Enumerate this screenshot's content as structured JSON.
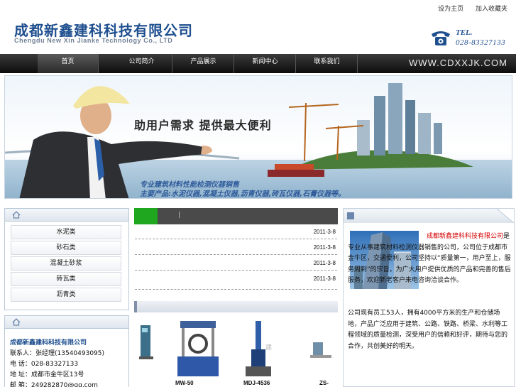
{
  "top_links": [
    "设为主页",
    "加入收藏夹"
  ],
  "logo": {
    "cn": "成都新鑫建科科技有限公司",
    "en": "Chengdu New Xin Jianke Technology Co., LTD"
  },
  "tel": {
    "label": "TEL.",
    "number": "028-83327133"
  },
  "nav": {
    "items": [
      "首页",
      "公司简介",
      "产品展示",
      "新闻中心",
      "联系我们"
    ],
    "url": "WWW.CDXXJK.COM"
  },
  "banner": {
    "slogan": "助用户需求  提供最大便利",
    "line1": "专业建筑材料性能检测仪器销售",
    "line2": "主要产品:水泥仪器,混凝土仪器,沥青仪器,砖瓦仪器,石膏仪器等。"
  },
  "categories": [
    "水泥类",
    "砂石类",
    "混凝土砂浆",
    "砖瓦类",
    "沥青类"
  ],
  "contact": {
    "title": "成都新鑫建科科技有限公司",
    "rows": [
      "联系人：张经理(13540493095)",
      "电  话：028-83327133",
      "地  址：成都市金牛区13号",
      "邮  箱：249282870@qq.com"
    ]
  },
  "news": {
    "tab_label": "|",
    "items": [
      {
        "title": "",
        "date": "2011-3-8"
      },
      {
        "title": "",
        "date": "2011-3-8"
      },
      {
        "title": "",
        "date": "2011-3-8"
      },
      {
        "title": "",
        "date": "2011-3-8"
      }
    ]
  },
  "products": [
    {
      "name": ""
    },
    {
      "name": "MW-50"
    },
    {
      "name": "MDJ-4536"
    },
    {
      "name": "ZS-"
    }
  ],
  "about": {
    "highlight": "成都新鑫建科科技有限公司",
    "p1": "是专业从事建筑材料检测仪器销售的公司，公司位于成都市金牛区，交通便利，公司坚持以“质量第一，用户至上，服务周到”的宗旨，为广大用户提供优质的产品和完善的售后服务，欢迎新老客户来电咨询洽谈合作。",
    "p2": "公司现有员工53人，拥有4000平方米的生产和仓储场地，产品广泛应用于建筑、公路、铁路、桥梁、水利等工程领域的质量检测，深受用户的信赖和好评，期待与您的合作，共创美好的明天。"
  }
}
